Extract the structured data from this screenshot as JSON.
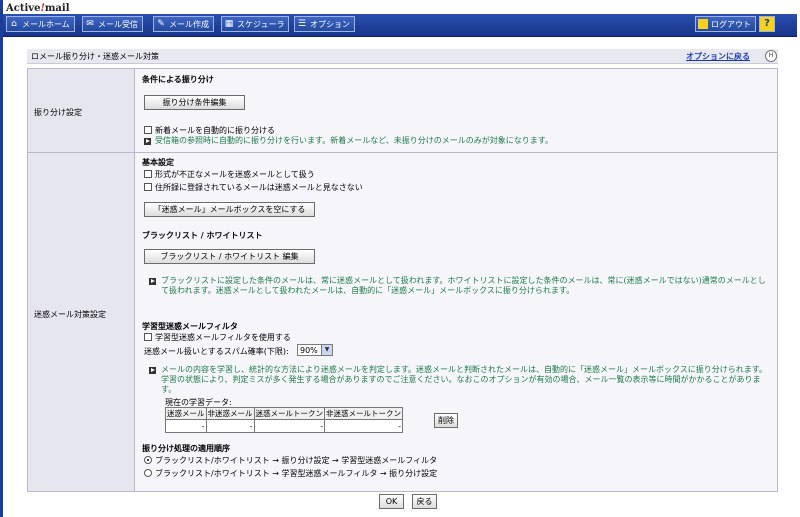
{
  "brand": {
    "part1": "Active",
    "slash": "!",
    "part2": "mail"
  },
  "nav": [
    {
      "label": "メールホーム",
      "icon": "home-icon"
    },
    {
      "label": "メール受信",
      "icon": "mail-inbox-icon"
    },
    {
      "label": "メール作成",
      "icon": "compose-icon"
    },
    {
      "label": "スケジューラ",
      "icon": "calendar-icon"
    },
    {
      "label": "オプション",
      "icon": "options-icon"
    }
  ],
  "logout_label": "ログアウト",
  "help_label": "?",
  "page_title": "ロメール振り分け・迷惑メール対策",
  "back_link": "オプションに戻る",
  "h_icon": "H",
  "section1": {
    "label": "振り分け設定",
    "heading": "条件による振り分け",
    "edit_button": "振り分け条件編集",
    "auto_checkbox": "新着メールを自動的に振り分ける",
    "note": "受信箱の参照時に自動的に振り分けを行います。新着メールなど、未振り分けのメールのみが対象になります。"
  },
  "section2": {
    "label": "迷惑メール対策設定",
    "basic_heading": "基本設定",
    "cb1": "形式が不正なメールを迷惑メールとして扱う",
    "cb2": "住所録に登録されているメールは迷惑メールと見なさない",
    "empty_button": "「迷惑メール」メールボックスを空にする",
    "bw_heading": "ブラックリスト / ホワイトリスト",
    "bw_button": "ブラックリスト / ホワイトリスト 編集",
    "bw_note": "ブラックリストに設定した条件のメールは、常に迷惑メールとして扱われます。ホワイトリストに設定した条件のメールは、常に(迷惑メールではない)通常のメールとして扱われます。迷惑メールとして扱われたメールは、自動的に「迷惑メール」メールボックスに振り分けられます。",
    "learn_heading": "学習型迷惑メールフィルタ",
    "learn_cb": "学習型迷惑メールフィルタを使用する",
    "threshold_label": "迷惑メール扱いとするスパム確率(下限):",
    "threshold_value": "90%",
    "learn_note": "メールの内容を学習し、統計的な方法により迷惑メールを判定します。迷惑メールと判断されたメールは、自動的に「迷惑メール」メールボックスに振り分けられます。学習の状態により、判定ミスが多く発生する場合がありますのでご注意ください。なおこのオプションが有効の場合、メール一覧の表示等に時間がかかることがあります。",
    "current_data_label": "現在の学習データ:",
    "columns": [
      "迷惑メール",
      "非迷惑メール",
      "迷惑メールトークン",
      "非迷惑メールトークン"
    ],
    "values": [
      "-",
      "-",
      "-",
      "-"
    ],
    "delete_button": "削除",
    "order_heading": "振り分け処理の適用順序",
    "order1": "ブラックリスト/ホワイトリスト → 振り分け設定 → 学習型迷惑メールフィルタ",
    "order2": "ブラックリスト/ホワイトリスト → 学習型迷惑メールフィルタ → 振り分け設定"
  },
  "ok_button": "OK",
  "back_button": "戻る"
}
